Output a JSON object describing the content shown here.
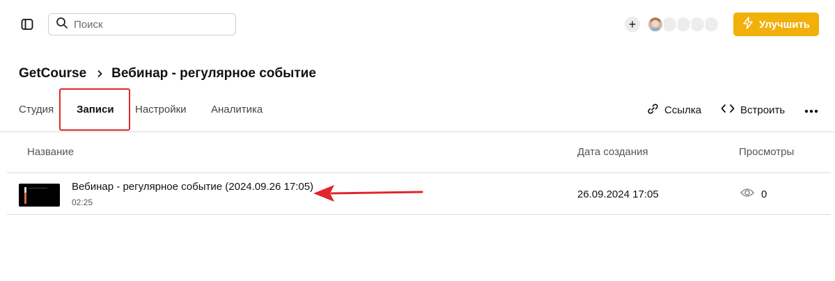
{
  "search": {
    "placeholder": "Поиск"
  },
  "header": {
    "upgrade_label": "Улучшить"
  },
  "breadcrumb": {
    "root": "GetCourse",
    "current": "Вебинар - регулярное событие"
  },
  "tabs": [
    {
      "label": "Студия"
    },
    {
      "label": "Записи",
      "active": true
    },
    {
      "label": "Настройки"
    },
    {
      "label": "Аналитика"
    }
  ],
  "actions": {
    "link_label": "Ссылка",
    "embed_label": "Встроить"
  },
  "table": {
    "columns": {
      "name": "Название",
      "created": "Дата создания",
      "views": "Просмотры"
    },
    "rows": [
      {
        "title": "Вебинар - регулярное событие (2024.09.26 17:05)",
        "duration": "02:25",
        "created": "26.09.2024 17:05",
        "views": "0"
      }
    ]
  },
  "colors": {
    "accent": "#f2b00b",
    "highlight": "#e0262b",
    "annotation_arrow": "#e0262b"
  },
  "icons": [
    "sidebar-toggle-icon",
    "search-icon",
    "plus-icon",
    "lightning-icon",
    "chevron-right-icon",
    "link-icon",
    "code-icon",
    "more-icon",
    "eye-icon"
  ]
}
